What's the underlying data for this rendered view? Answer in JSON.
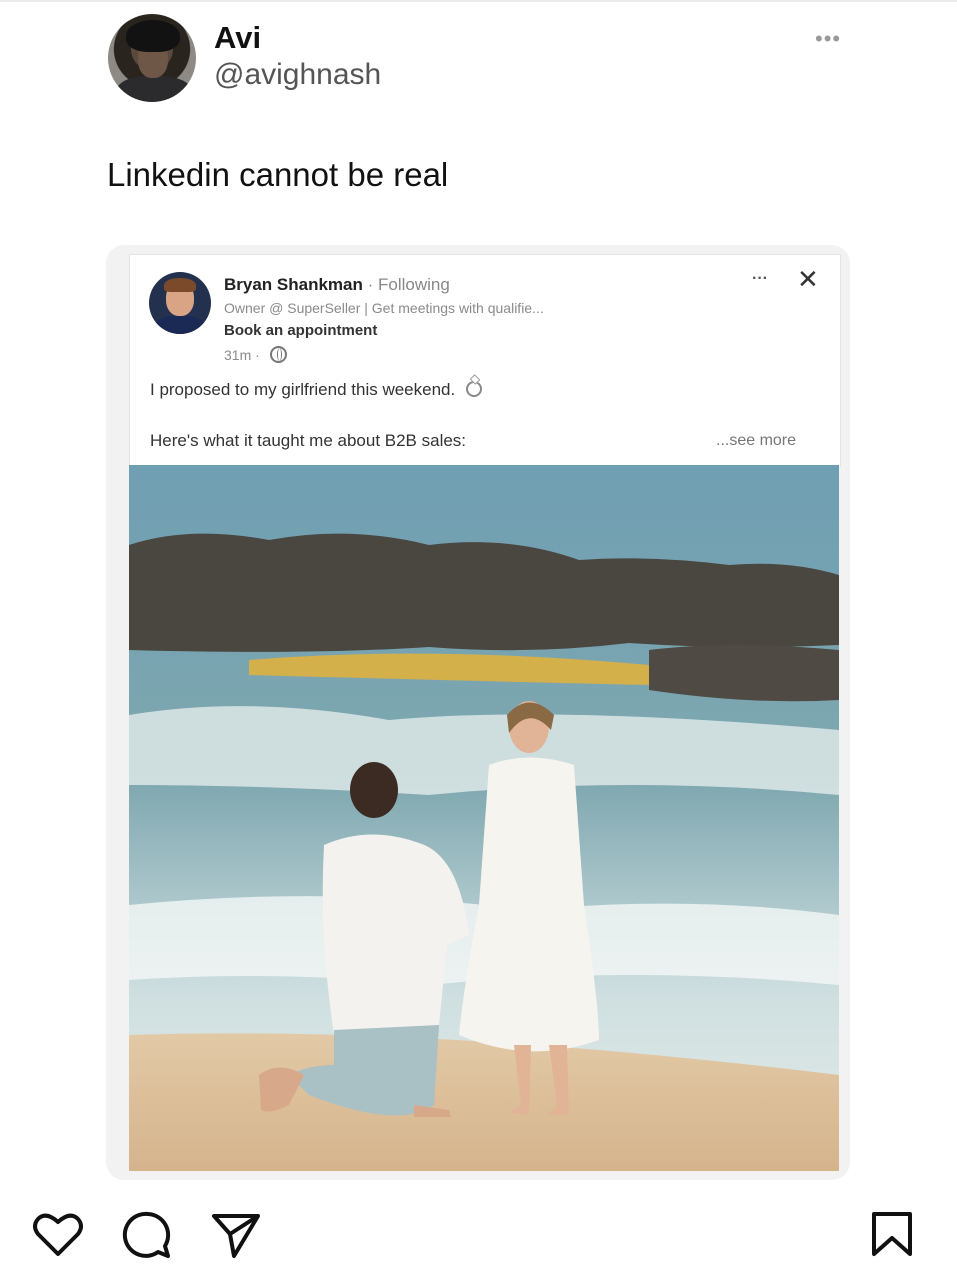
{
  "tweet": {
    "author_name": "Avi",
    "author_handle": "@avighnash",
    "more_label": "•••",
    "text": "Linkedin cannot be real"
  },
  "linkedin_post": {
    "author_name": "Bryan Shankman",
    "separator": "·",
    "follow_status": "Following",
    "subtitle": "Owner @ SuperSeller | Get meetings with qualifie...",
    "cta": "Book an appointment",
    "time": "31m ·",
    "more_label": "···",
    "close_label": "✕",
    "line1": "I proposed to my girlfriend this weekend.",
    "line2": "Here's what it taught me about B2B sales:",
    "see_more": "...see more",
    "image_icon": "beach-proposal-photo"
  },
  "actions": {
    "icons": [
      "heart-icon",
      "comment-icon",
      "share-icon",
      "bookmark-icon"
    ]
  },
  "colors": {
    "background": "#ffffff",
    "quote_background": "#f2f2f2",
    "muted_text": "#8a8a8a"
  }
}
